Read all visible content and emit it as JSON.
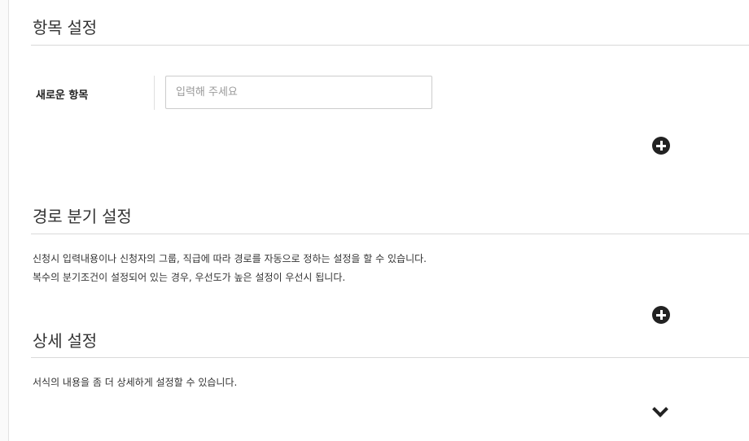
{
  "items_section": {
    "title": "항목 설정",
    "new_item_label": "새로운 항목",
    "new_item_placeholder": "입력해 주세요",
    "new_item_value": "",
    "add_icon": "plus-circle-icon"
  },
  "branch_section": {
    "title": "경로 분기 설정",
    "description_line1": "신청시 입력내용이나 신청자의 그룹, 직급에 따라 경로를 자동으로 정하는 설정을 할 수 있습니다.",
    "description_line2": "복수의 분기조건이 설정되어 있는 경우, 우선도가 높은 설정이 우선시 됩니다.",
    "add_icon": "plus-circle-icon"
  },
  "detail_section": {
    "title": "상세 설정",
    "description": "서식의 내용을 좀 더 상세하게 설정할 수 있습니다.",
    "expand_icon": "chevron-down-icon"
  }
}
